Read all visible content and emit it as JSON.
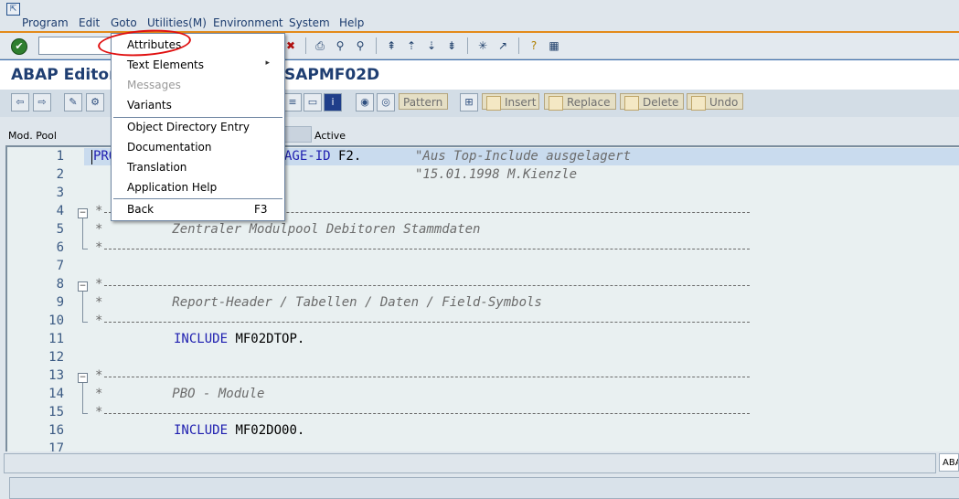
{
  "menubar": {
    "items": [
      "Program",
      "Edit",
      "Goto",
      "Utilities(M)",
      "Environment",
      "System",
      "Help"
    ]
  },
  "title": {
    "left": "ABAP Editor",
    "right": "SAPMF02D"
  },
  "app_toolbar": {
    "pattern": "Pattern",
    "insert": "Insert",
    "replace": "Replace",
    "delete": "Delete",
    "undo": "Undo"
  },
  "info": {
    "type_label": "Mod. Pool",
    "status": "Active"
  },
  "goto_menu": {
    "items": [
      {
        "label": "Attributes",
        "enabled": true
      },
      {
        "label": "Text Elements",
        "enabled": true,
        "submenu": true
      },
      {
        "label": "Messages",
        "enabled": false
      },
      {
        "label": "Variants",
        "enabled": true
      },
      {
        "label": "Object Directory Entry",
        "enabled": true
      },
      {
        "label": "Documentation",
        "enabled": true
      },
      {
        "label": "Translation",
        "enabled": true
      },
      {
        "label": "Application Help",
        "enabled": true
      },
      {
        "label": "Back",
        "enabled": true,
        "shortcut": "F3"
      }
    ]
  },
  "editor": {
    "line_numbers": [
      "1",
      "2",
      "3",
      "4",
      "5",
      "6",
      "7",
      "8",
      "9",
      "10",
      "11",
      "12",
      "13",
      "14",
      "15",
      "16",
      "17"
    ],
    "lines": {
      "l1_kw_a": "PRO",
      "l1_kw_b": "AGE-ID",
      "l1_rest": " F2.",
      "l1_comment": "\"Aus Top-Include ausgelagert",
      "l2_comment": "\"15.01.1998 M.Kienzle",
      "l5": "*         Zentraler Modulpool Debitoren Stammdaten",
      "l9": "*         Report-Header / Tabellen / Daten / Field-Symbols",
      "l11_kw": "INCLUDE",
      "l11_rest": " MF02DTOP.",
      "l14": "*         PBO - Module",
      "l16_kw": "INCLUDE",
      "l16_rest": " MF02DO00.",
      "star": "*"
    }
  },
  "statusbar": {
    "sysinfo": "ABA"
  },
  "colors": {
    "accent_orange": "#e38a1a",
    "title_blue": "#1f3e72",
    "keyword_blue": "#1f1fb0",
    "annotation_red": "#e01010"
  }
}
